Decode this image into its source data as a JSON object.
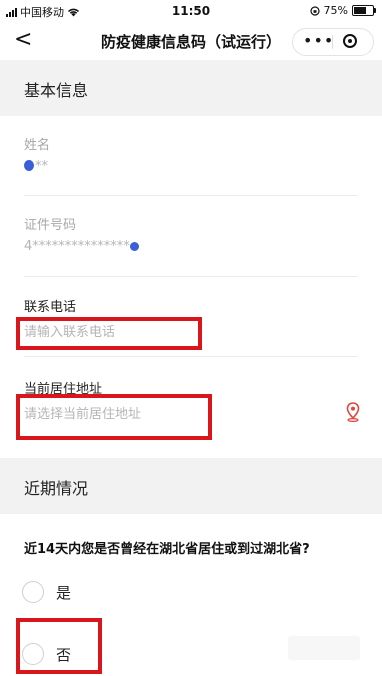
{
  "status_bar": {
    "carrier": "中国移动",
    "time": "11:50",
    "battery_percent": "75%",
    "battery_level": 0.75
  },
  "nav": {
    "back_glyph": "<",
    "title": "防疫健康信息码（试运行）",
    "more_glyph": "•••"
  },
  "basic_info": {
    "header": "基本信息",
    "name": {
      "label": "姓名",
      "value": "**"
    },
    "id_number": {
      "label": "证件号码",
      "value": "4***************"
    },
    "phone": {
      "label": "联系电话",
      "placeholder": "请输入联系电话"
    },
    "address": {
      "label": "当前居住地址",
      "placeholder": "请选择当前居住地址"
    }
  },
  "recent": {
    "header": "近期情况",
    "question": "近14天内您是否曾经在湖北省居住或到过湖北省?",
    "options": [
      {
        "label": "是"
      },
      {
        "label": "否"
      }
    ]
  },
  "colors": {
    "annotation_red": "#d9161b",
    "pin_red": "#e0473e",
    "header_bg": "#f2f2f2"
  }
}
